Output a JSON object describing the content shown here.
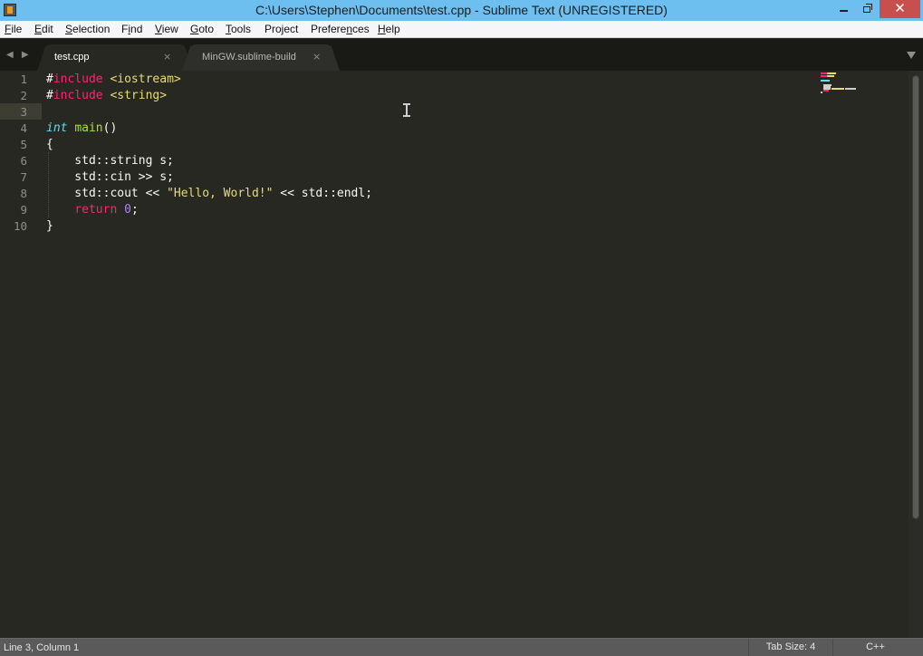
{
  "window": {
    "title": "C:\\Users\\Stephen\\Documents\\test.cpp - Sublime Text (UNREGISTERED)",
    "minimize": "minimize",
    "restore": "restore",
    "close": "✕"
  },
  "menu": [
    {
      "pre": "",
      "ul": "F",
      "post": "ile"
    },
    {
      "pre": "",
      "ul": "E",
      "post": "dit"
    },
    {
      "pre": "",
      "ul": "S",
      "post": "election"
    },
    {
      "pre": "F",
      "ul": "i",
      "post": "nd"
    },
    {
      "pre": "",
      "ul": "V",
      "post": "iew"
    },
    {
      "pre": "",
      "ul": "G",
      "post": "oto"
    },
    {
      "pre": "",
      "ul": "T",
      "post": "ools"
    },
    {
      "pre": "Project",
      "ul": "",
      "post": ""
    },
    {
      "pre": "Prefere",
      "ul": "n",
      "post": "ces"
    },
    {
      "pre": "",
      "ul": "H",
      "post": "elp"
    }
  ],
  "tabs": {
    "nav": "◀ ▶",
    "items": [
      {
        "label": "test.cpp",
        "close": "×",
        "active": true
      },
      {
        "label": "MinGW.sublime-build",
        "close": "×",
        "active": false
      }
    ]
  },
  "editor": {
    "current_line": 3,
    "lines": [
      {
        "n": "1",
        "tokens": [
          [
            "hash",
            "#"
          ],
          [
            "kw-pp",
            "include"
          ],
          [
            "",
            " "
          ],
          [
            "lib",
            "<iostream>"
          ]
        ]
      },
      {
        "n": "2",
        "tokens": [
          [
            "hash",
            "#"
          ],
          [
            "kw-pp",
            "include"
          ],
          [
            "",
            " "
          ],
          [
            "lib",
            "<string>"
          ]
        ]
      },
      {
        "n": "3",
        "tokens": []
      },
      {
        "n": "4",
        "tokens": [
          [
            "type",
            "int"
          ],
          [
            "",
            " "
          ],
          [
            "fn",
            "main"
          ],
          [
            "",
            "()"
          ]
        ]
      },
      {
        "n": "5",
        "tokens": [
          [
            "",
            "{"
          ]
        ]
      },
      {
        "n": "6",
        "tokens": [
          [
            "",
            "    std::string s;"
          ]
        ]
      },
      {
        "n": "7",
        "tokens": [
          [
            "",
            "    std::cin >> s;"
          ]
        ]
      },
      {
        "n": "8",
        "tokens": [
          [
            "",
            "    std::cout << "
          ],
          [
            "str",
            "\"Hello, World!\""
          ],
          [
            "",
            " << std::endl;"
          ]
        ]
      },
      {
        "n": "9",
        "tokens": [
          [
            "",
            "    "
          ],
          [
            "kw",
            "return"
          ],
          [
            "",
            " "
          ],
          [
            "num",
            "0"
          ],
          [
            "",
            ";"
          ]
        ]
      },
      {
        "n": "10",
        "tokens": [
          [
            "",
            "}"
          ]
        ]
      }
    ]
  },
  "status": {
    "position": "Line 3, Column 1",
    "tab_size": "Tab Size: 4",
    "syntax": "C++"
  },
  "colors": {
    "background": "#272822",
    "keyword": "#f92672",
    "string": "#e6db74",
    "type": "#66d9ef",
    "function": "#a6e22e",
    "number": "#ae81ff",
    "titlebar": "#6cbfee",
    "close_button": "#c7504f"
  }
}
